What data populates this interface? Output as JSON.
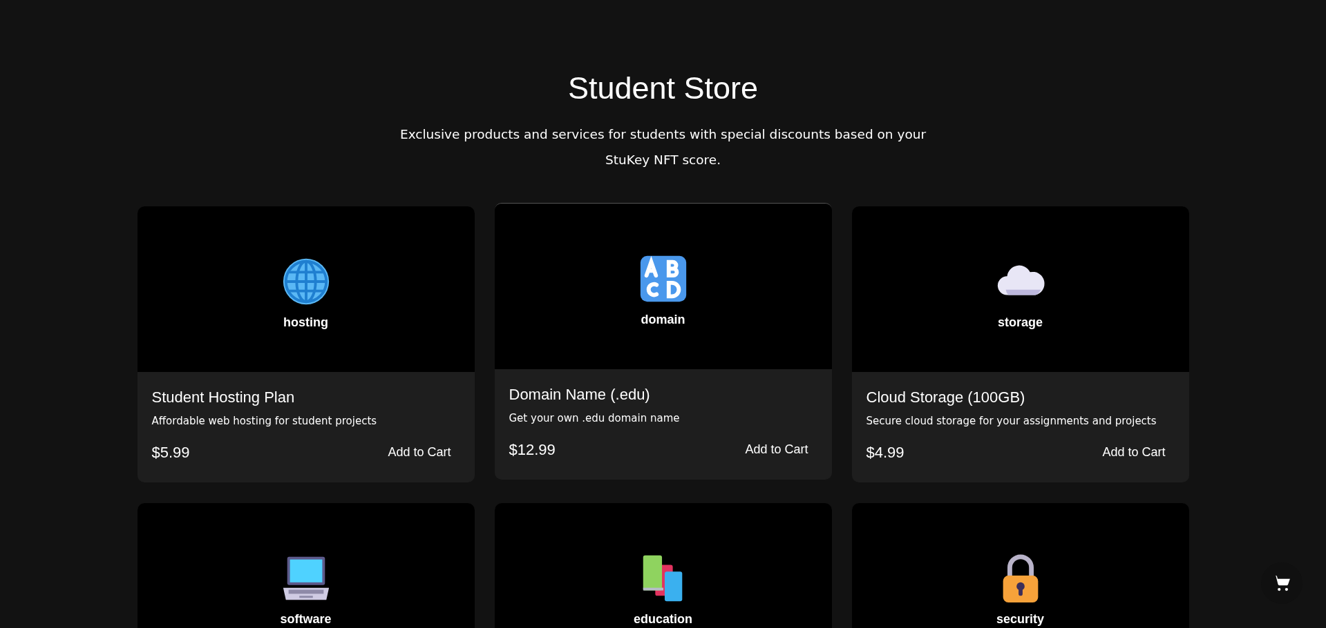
{
  "header": {
    "title": "Student Store",
    "subtitle": "Exclusive products and services for students with special discounts based on your StuKey NFT score."
  },
  "products": [
    {
      "category": "hosting",
      "name": "Student Hosting Plan",
      "description": "Affordable web hosting for student projects",
      "price": "$5.99",
      "button": "Add to Cart",
      "hovered": false
    },
    {
      "category": "domain",
      "name": "Domain Name (.edu)",
      "description": "Get your own .edu domain name",
      "price": "$12.99",
      "button": "Add to Cart",
      "hovered": true
    },
    {
      "category": "storage",
      "name": "Cloud Storage (100GB)",
      "description": "Secure cloud storage for your assignments and projects",
      "price": "$4.99",
      "button": "Add to Cart",
      "hovered": false
    },
    {
      "category": "software",
      "hovered": false
    },
    {
      "category": "education",
      "hovered": false
    },
    {
      "category": "security",
      "hovered": false
    }
  ]
}
